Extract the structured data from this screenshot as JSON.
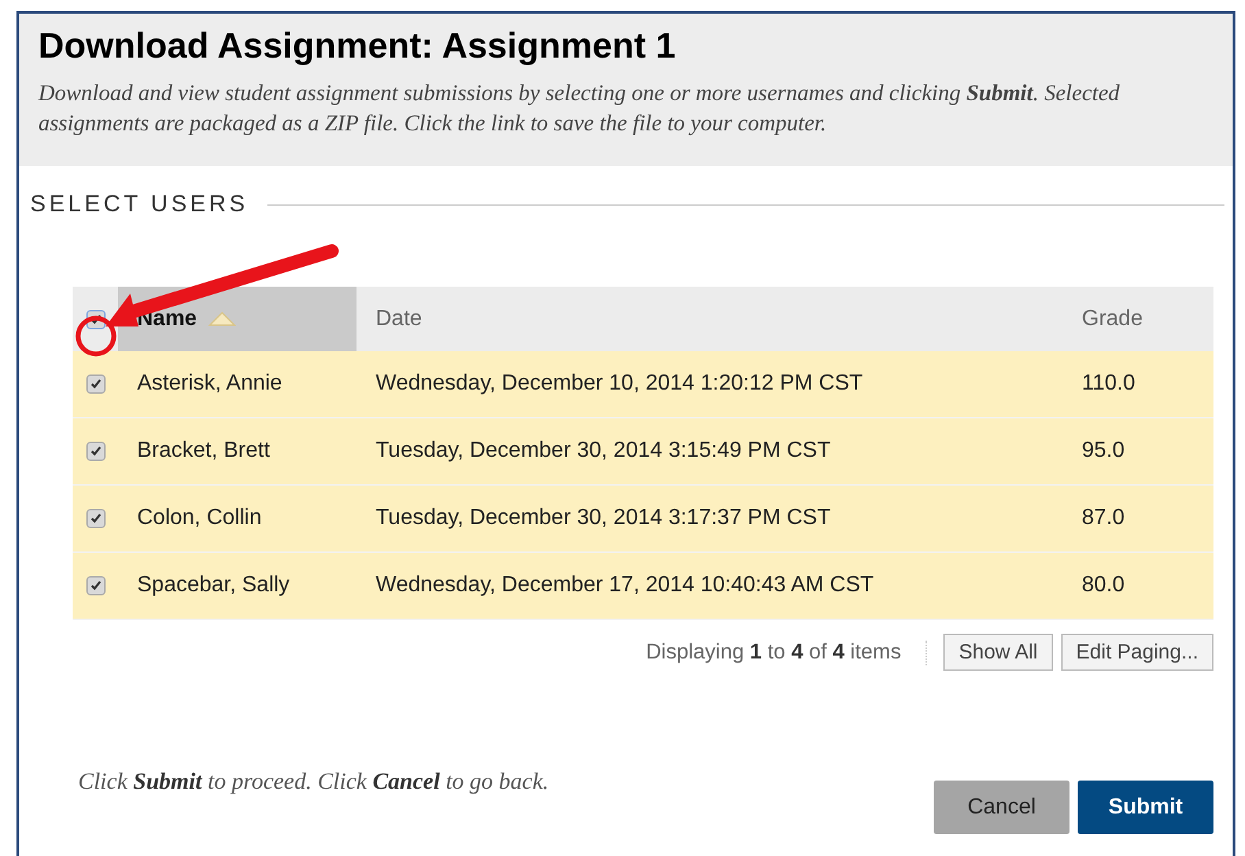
{
  "header": {
    "title": "Download Assignment: Assignment 1",
    "description": "Download and view student assignment submissions by selecting one or more usernames and clicking **Submit**. Selected assignments are packaged as a ZIP file. Click the link to save the file to your computer."
  },
  "section": {
    "title": "SELECT USERS"
  },
  "table": {
    "select_all": {
      "checked": true
    },
    "columns": [
      {
        "label": "Name",
        "sorted": true
      },
      {
        "label": "Date",
        "sorted": false
      },
      {
        "label": "Grade",
        "sorted": false
      }
    ],
    "rows": [
      {
        "checked": true,
        "name": "Asterisk, Annie",
        "date": "Wednesday, December 10, 2014 1:20:12 PM CST",
        "grade": "110.0"
      },
      {
        "checked": true,
        "name": "Bracket, Brett",
        "date": "Tuesday, December 30, 2014 3:15:49 PM CST",
        "grade": "95.0"
      },
      {
        "checked": true,
        "name": "Colon, Collin",
        "date": "Tuesday, December 30, 2014 3:17:37 PM CST",
        "grade": "87.0"
      },
      {
        "checked": true,
        "name": "Spacebar, Sally",
        "date": "Wednesday, December 17, 2014 10:40:43 AM CST",
        "grade": "80.0"
      }
    ]
  },
  "paging": {
    "summary": "Displaying **1** to **4** of **4** items",
    "buttons": [
      "Show All",
      "Edit Paging..."
    ]
  },
  "footer": {
    "instruction": "Click **Submit** to proceed. Click **Cancel** to go back.",
    "buttons": [
      {
        "label": "Cancel",
        "kind": "secondary"
      },
      {
        "label": "Submit",
        "kind": "primary"
      }
    ]
  }
}
